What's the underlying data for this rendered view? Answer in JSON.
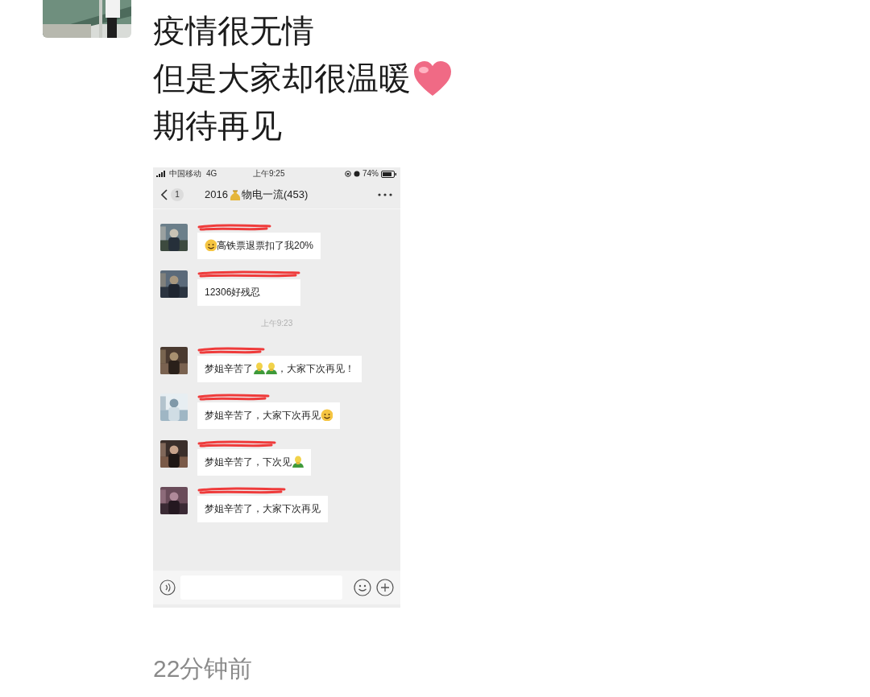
{
  "post": {
    "lines": [
      "疫情很无情",
      "但是大家却很温暖",
      "期待再见"
    ],
    "time": "22分钟前"
  },
  "screenshot": {
    "status_bar": {
      "carrier": "中国移动",
      "network": "4G",
      "time": "上午9:25",
      "battery": "74%"
    },
    "header": {
      "badge": "1",
      "title": [
        {
          "kind": "text",
          "text": "2016"
        },
        {
          "kind": "bag"
        },
        {
          "kind": "text",
          "text": "物电一流(453)"
        }
      ]
    },
    "messages": [
      {
        "kind": "message",
        "parts": [
          {
            "kind": "face"
          },
          {
            "kind": "text",
            "text": "高铁票退票扣了我20%"
          }
        ]
      },
      {
        "kind": "message",
        "parts": [
          {
            "kind": "text",
            "text": "12306好残忍"
          }
        ]
      },
      {
        "kind": "time",
        "text": "上午9:23"
      },
      {
        "kind": "message",
        "parts": [
          {
            "kind": "text",
            "text": "梦姐辛苦了"
          },
          {
            "kind": "figure"
          },
          {
            "kind": "figure"
          },
          {
            "kind": "text",
            "text": "，大家下次再见！"
          }
        ]
      },
      {
        "kind": "message",
        "parts": [
          {
            "kind": "text",
            "text": "梦姐辛苦了，大家下次再见"
          },
          {
            "kind": "face"
          }
        ]
      },
      {
        "kind": "message",
        "parts": [
          {
            "kind": "text",
            "text": "梦姐辛苦了，下次见"
          },
          {
            "kind": "figure"
          }
        ]
      },
      {
        "kind": "message",
        "parts": [
          {
            "kind": "text",
            "text": "梦姐辛苦了，大家下次再见"
          }
        ]
      }
    ]
  }
}
